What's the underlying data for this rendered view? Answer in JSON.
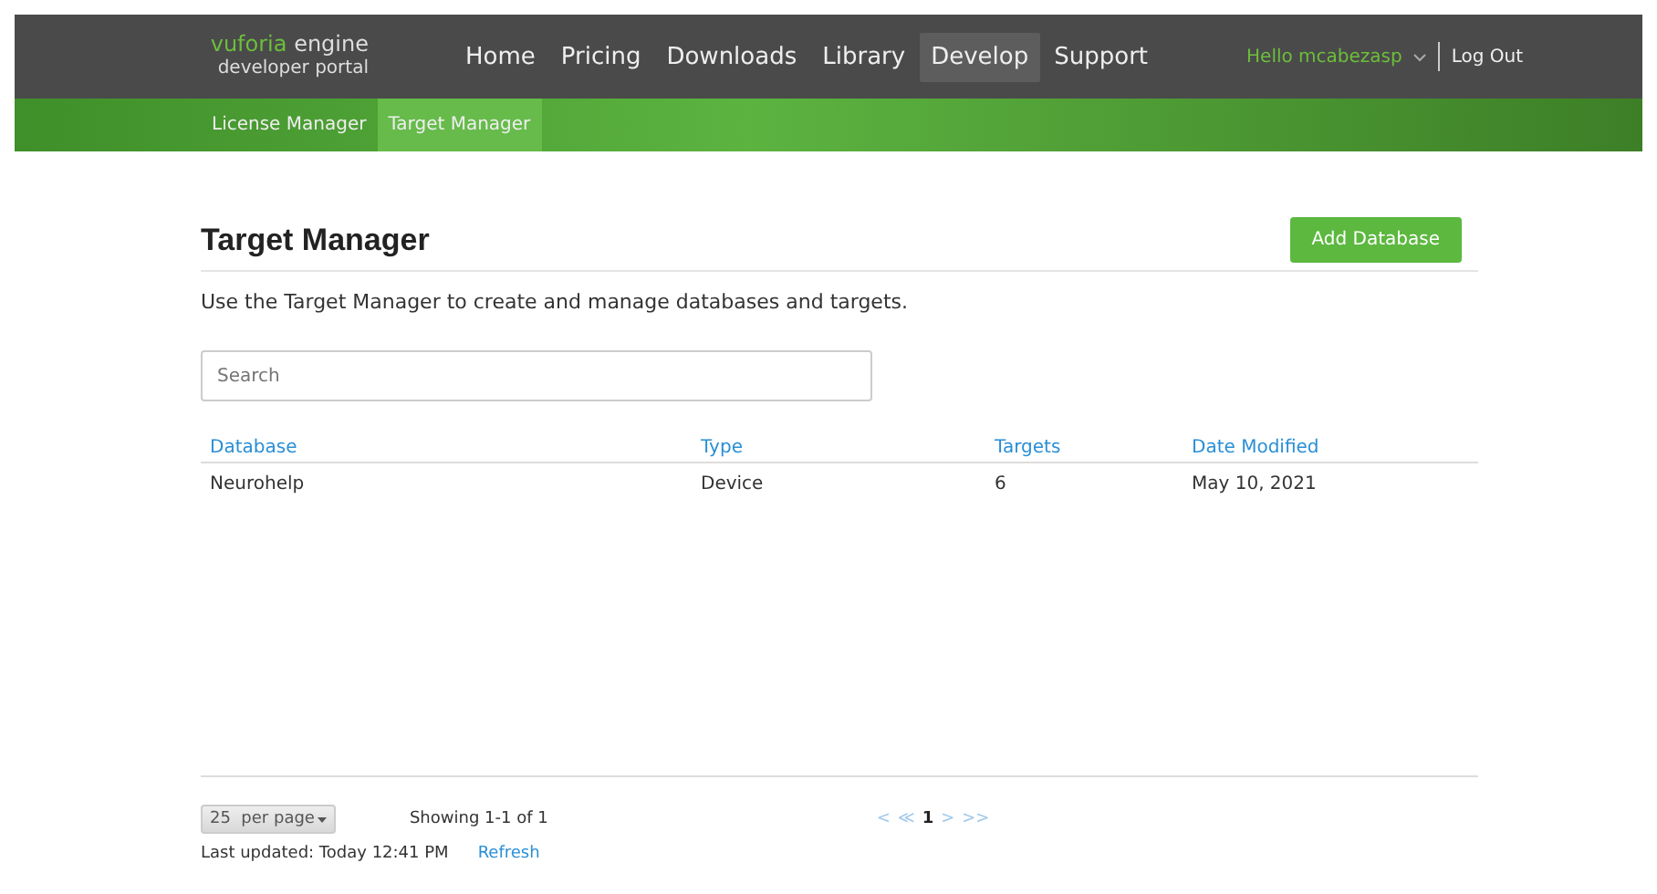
{
  "brand": {
    "logo_word": "vuforia",
    "logo_product": "engine",
    "subtitle": "developer portal"
  },
  "nav": [
    {
      "label": "Home",
      "selected": false
    },
    {
      "label": "Pricing",
      "selected": false
    },
    {
      "label": "Downloads",
      "selected": false
    },
    {
      "label": "Library",
      "selected": false
    },
    {
      "label": "Develop",
      "selected": true
    },
    {
      "label": "Support",
      "selected": false
    }
  ],
  "user": {
    "greeting": "Hello mcabezasp",
    "logout": "Log Out"
  },
  "subnav": [
    {
      "label": "License Manager",
      "selected": false
    },
    {
      "label": "Target Manager",
      "selected": true
    }
  ],
  "page": {
    "title": "Target Manager",
    "add_button": "Add Database",
    "description": "Use the Target Manager to create and manage databases and targets."
  },
  "search": {
    "placeholder": "Search"
  },
  "table": {
    "columns": [
      "Database",
      "Type",
      "Targets",
      "Date Modified"
    ],
    "rows": [
      [
        "Neurohelp",
        "Device",
        "6",
        "May 10, 2021"
      ]
    ]
  },
  "footer": {
    "per_page": "25  per page",
    "showing": "Showing 1-1 of 1",
    "pager": [
      {
        "label": "<",
        "selected": false
      },
      {
        "label": "≪",
        "selected": false
      },
      {
        "label": "1",
        "selected": true
      },
      {
        "label": ">",
        "selected": false
      },
      {
        "label": ">>",
        "selected": false
      }
    ],
    "last_updated": "Last updated: Today 12:41 PM",
    "refresh": "Refresh"
  }
}
